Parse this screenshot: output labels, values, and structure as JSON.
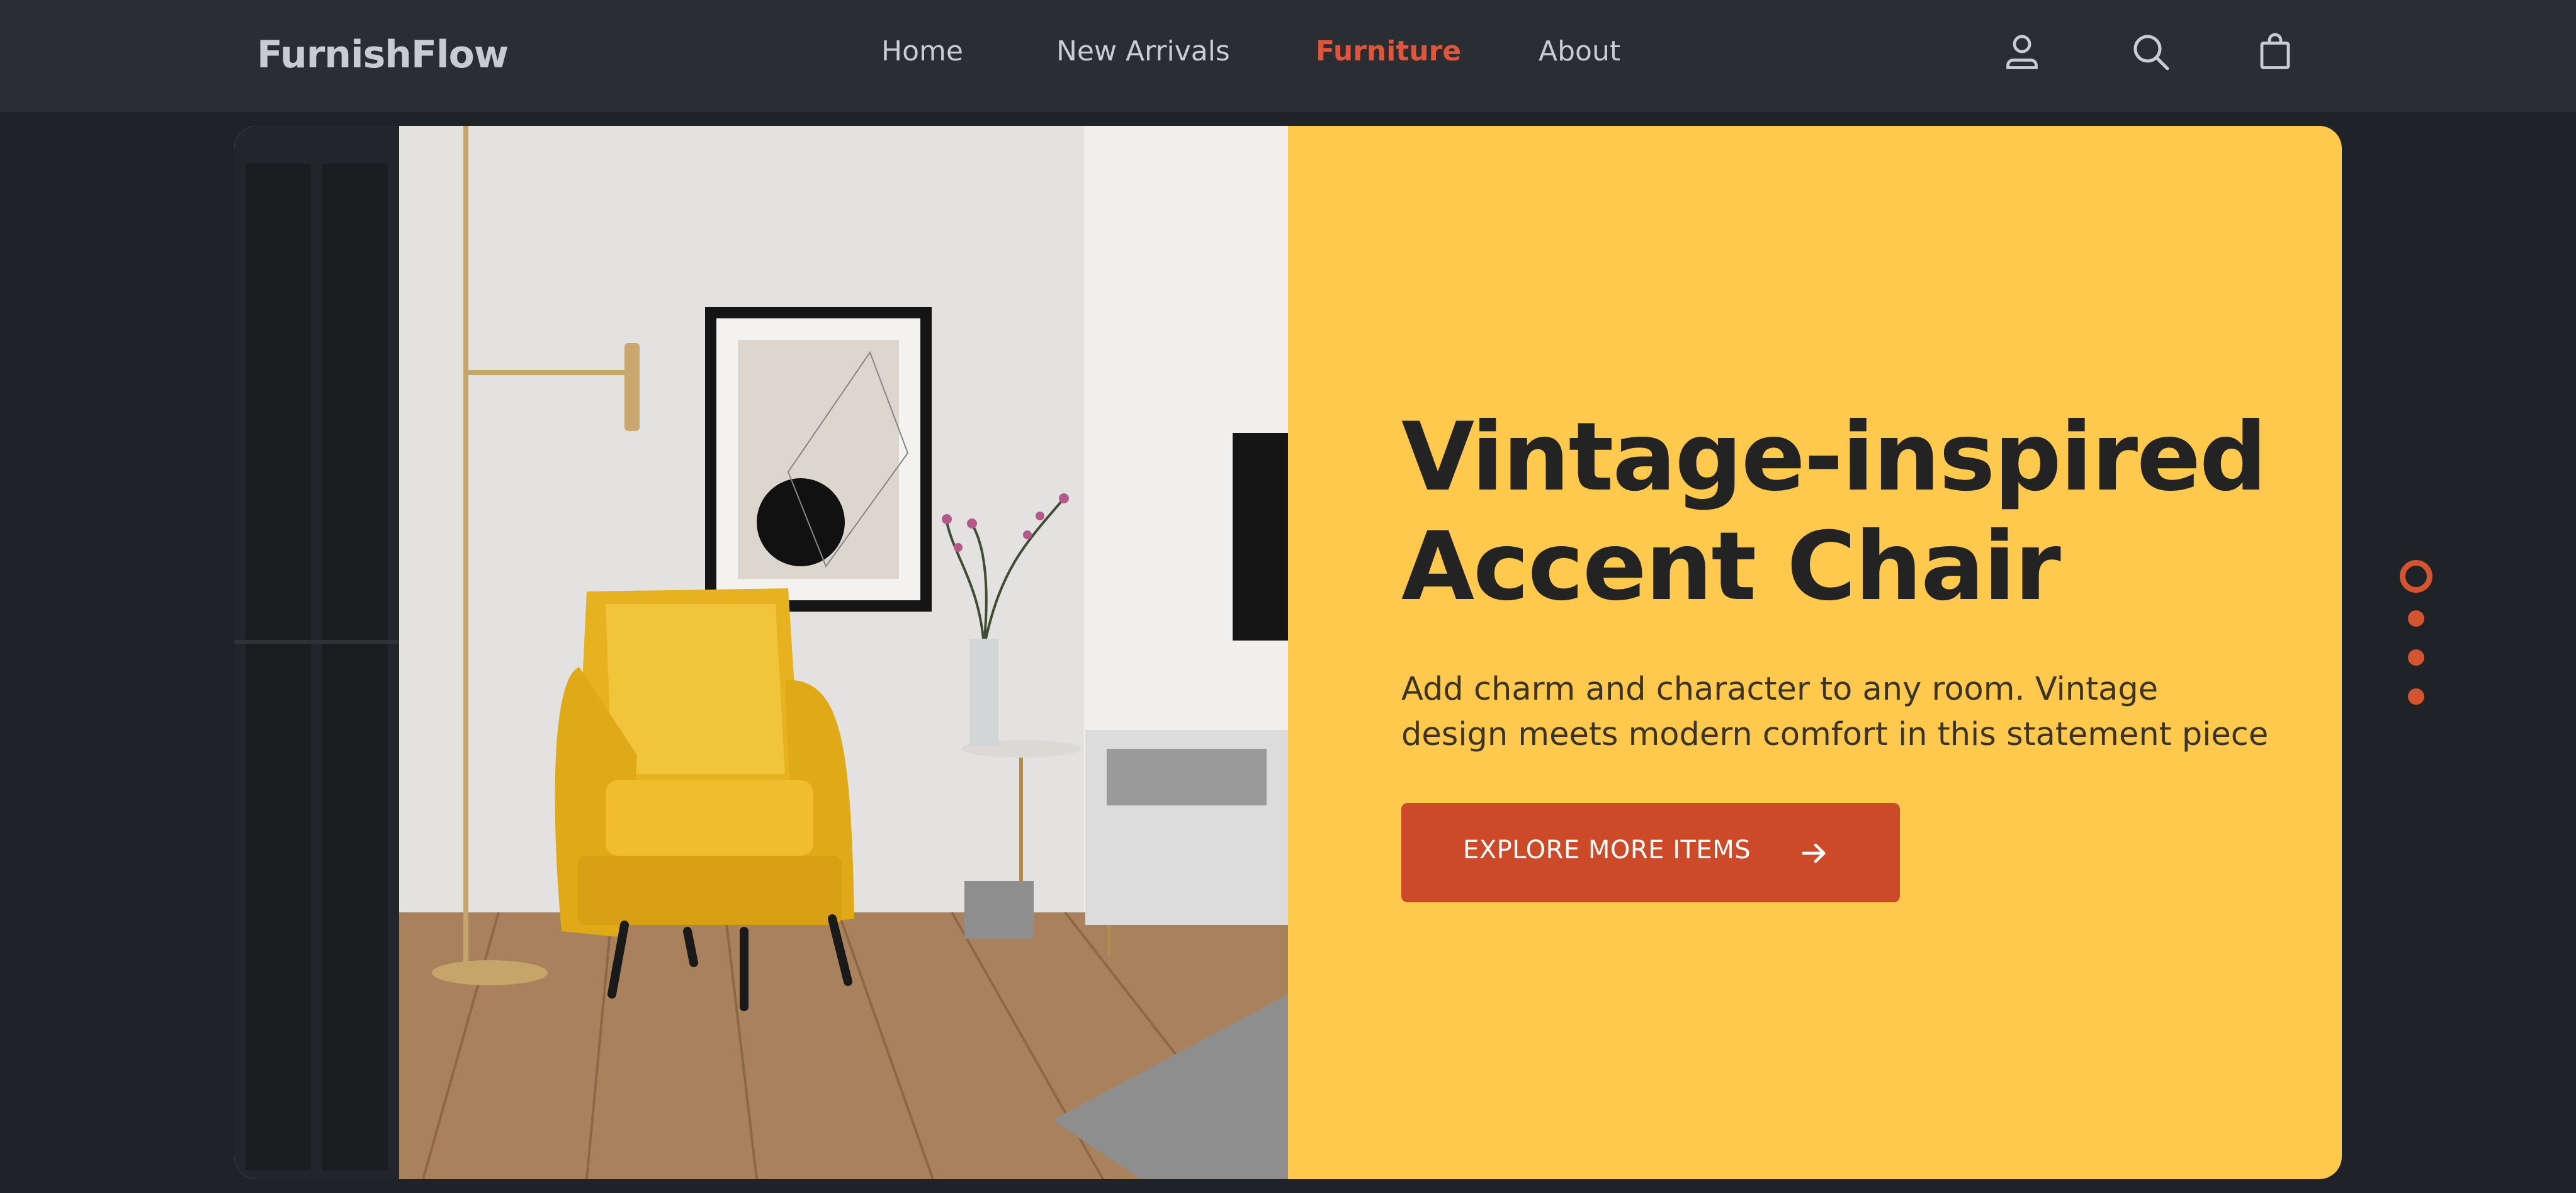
{
  "brand": {
    "name": "FurnishFlow"
  },
  "nav": {
    "links": [
      {
        "label": "Home",
        "active": false
      },
      {
        "label": "New Arrivals",
        "active": false
      },
      {
        "label": "Furniture",
        "active": true
      },
      {
        "label": "About",
        "active": false
      }
    ],
    "icons": [
      "user-icon",
      "search-icon",
      "shopping-bag-icon"
    ]
  },
  "hero": {
    "title_line1": "Vintage-inspired",
    "title_line2": "Accent Chair",
    "description": "Add charm and character to any room. Vintage design meets modern comfort in this statement piece",
    "cta_label": "EXPLORE MORE ITEMS",
    "cta_icon": "arrow-right-icon",
    "panel_color": "#ffc94d",
    "accent_color": "#cc4a27"
  },
  "carousel": {
    "slide_count": 4,
    "active_index": 0
  }
}
